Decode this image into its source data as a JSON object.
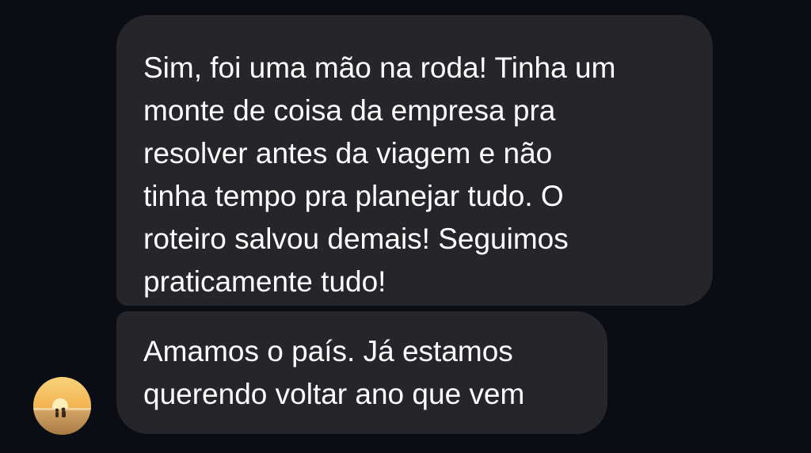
{
  "chat": {
    "messages": [
      {
        "sender": "contact",
        "lines": [
          "Sim, foi uma mão na roda! Tinha um",
          "monte de coisa da empresa pra",
          "resolver antes da viagem e não",
          "tinha tempo pra planejar tudo. O",
          "roteiro salvou demais! Seguimos",
          "praticamente tudo!"
        ]
      },
      {
        "sender": "contact",
        "lines": [
          "Amamos o país. Já estamos",
          "querendo voltar ano que vem"
        ]
      }
    ],
    "avatar": {
      "icon": "sunset-beach-avatar",
      "colors": {
        "sky_top": "#f7d27a",
        "sky_mid": "#f2b24f",
        "sun": "#fff4c8",
        "sand": "#c99a5c",
        "figures": "#3a2a1c"
      }
    },
    "colors": {
      "background": "#0b0d14",
      "bubble": "#26262a",
      "text": "#ffffff"
    }
  }
}
